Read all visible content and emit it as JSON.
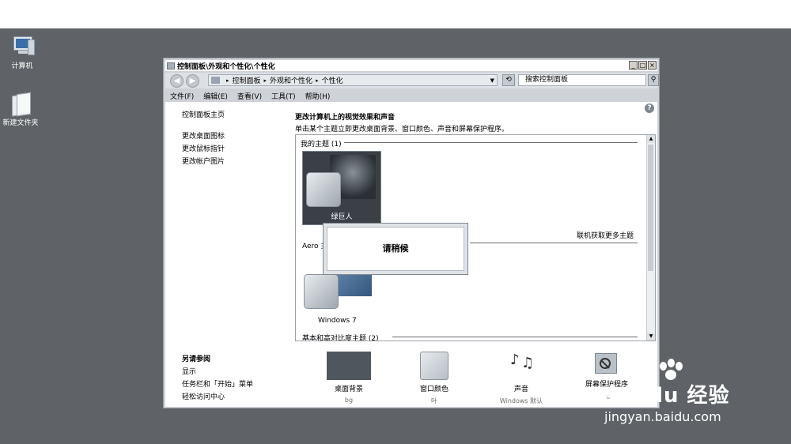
{
  "desktop": {
    "icons": [
      {
        "label": "计算机"
      },
      {
        "label": "新建文件夹"
      }
    ]
  },
  "window": {
    "title": "控制面板\\外观和个性化\\个性化",
    "controls": {
      "minimize": "_",
      "maximize": "□",
      "close": "×"
    },
    "address": {
      "crumbs": [
        "控制面板",
        "外观和个性化",
        "个性化"
      ],
      "search_placeholder": "搜索控制面板"
    },
    "menu": [
      "文件(F)",
      "编辑(E)",
      "查看(V)",
      "工具(T)",
      "帮助(H)"
    ],
    "help": "?",
    "left_nav": {
      "home": "控制面板主页",
      "links": [
        "更改桌面图标",
        "更改鼠标指针",
        "更改帐户图片"
      ]
    },
    "see_also": {
      "title": "另请参阅",
      "links": [
        "显示",
        "任务栏和「开始」菜单",
        "轻松访问中心"
      ]
    },
    "main": {
      "heading": "更改计算机上的视觉效果和声音",
      "subheading": "单击某个主题立即更改桌面背景、窗口颜色、声音和屏幕保护程序。",
      "my_themes_label": "我的主题 (1)",
      "hulk_theme_label": "绿巨人",
      "aero_label": "Aero 主",
      "online_link": "联机获取更多主题",
      "win7_label": "Windows 7",
      "basic_label": "基本和高对比度主题 (2)"
    },
    "bottom": [
      {
        "label": "桌面背景",
        "sub": "bg"
      },
      {
        "label": "窗口颜色",
        "sub": "叶"
      },
      {
        "label": "声音",
        "sub": "Windows 默认"
      },
      {
        "label": "屏幕保护程序",
        "sub": "无"
      }
    ]
  },
  "dialog": {
    "text": "请稍候"
  },
  "watermark": {
    "brand": "Bai du 经验",
    "url": "jingyan.baidu.com"
  }
}
